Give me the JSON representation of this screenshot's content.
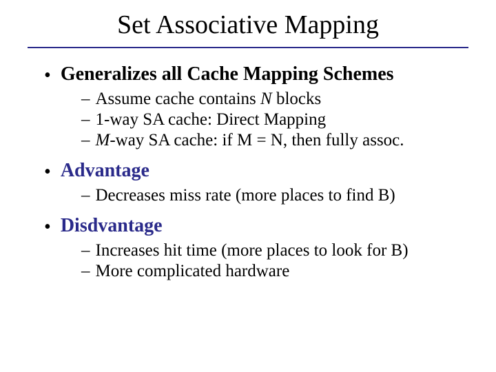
{
  "title": "Set Associative Mapping",
  "bullets": [
    {
      "text": "Generalizes all Cache Mapping Schemes",
      "accent": false,
      "subs": [
        {
          "pre": "Assume cache contains ",
          "em": "N",
          "post": " blocks"
        },
        {
          "pre": "1-way SA cache:  Direct Mapping",
          "em": "",
          "post": ""
        },
        {
          "pre": "",
          "em": "M",
          "post": "-way SA cache: if M = N, then fully assoc."
        }
      ]
    },
    {
      "text": "Advantage",
      "accent": true,
      "subs": [
        {
          "pre": "Decreases miss rate (more places to find B)",
          "em": "",
          "post": ""
        }
      ]
    },
    {
      "text": "Disdvantage",
      "accent": true,
      "subs": [
        {
          "pre": "Increases hit time (more places to look for B)",
          "em": "",
          "post": ""
        },
        {
          "pre": "More complicated hardware",
          "em": "",
          "post": ""
        }
      ]
    }
  ]
}
